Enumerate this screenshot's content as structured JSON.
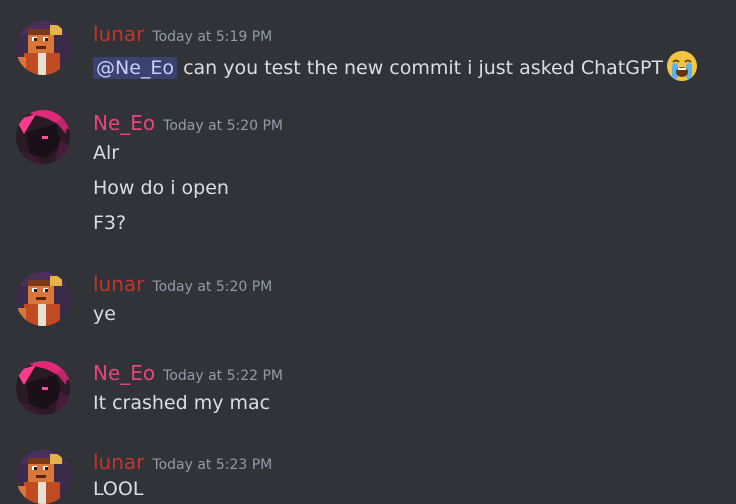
{
  "messages": [
    {
      "author": "lunar",
      "timestamp": "Today at 5:19 PM",
      "mention": "@Ne_Eo",
      "text": "can you test the new commit i just asked ChatGPT",
      "emoji": "loudly-crying-face"
    },
    {
      "author": "Ne_Eo",
      "timestamp": "Today at 5:20 PM",
      "lines": [
        "Alr",
        "How do i open",
        "F3?"
      ]
    },
    {
      "author": "lunar",
      "timestamp": "Today at 5:20 PM",
      "lines": [
        "ye"
      ]
    },
    {
      "author": "Ne_Eo",
      "timestamp": "Today at 5:22 PM",
      "lines": [
        "It crashed my mac"
      ]
    },
    {
      "author": "lunar",
      "timestamp": "Today at 5:23 PM",
      "lines": [
        "LOOL"
      ]
    }
  ],
  "colors": {
    "background": "#313338",
    "lunar_name": "#c0362c",
    "neeo_name": "#e8457a",
    "timestamp": "#949ba4",
    "text": "#dbdee1",
    "mention_bg": "#3c4270"
  }
}
